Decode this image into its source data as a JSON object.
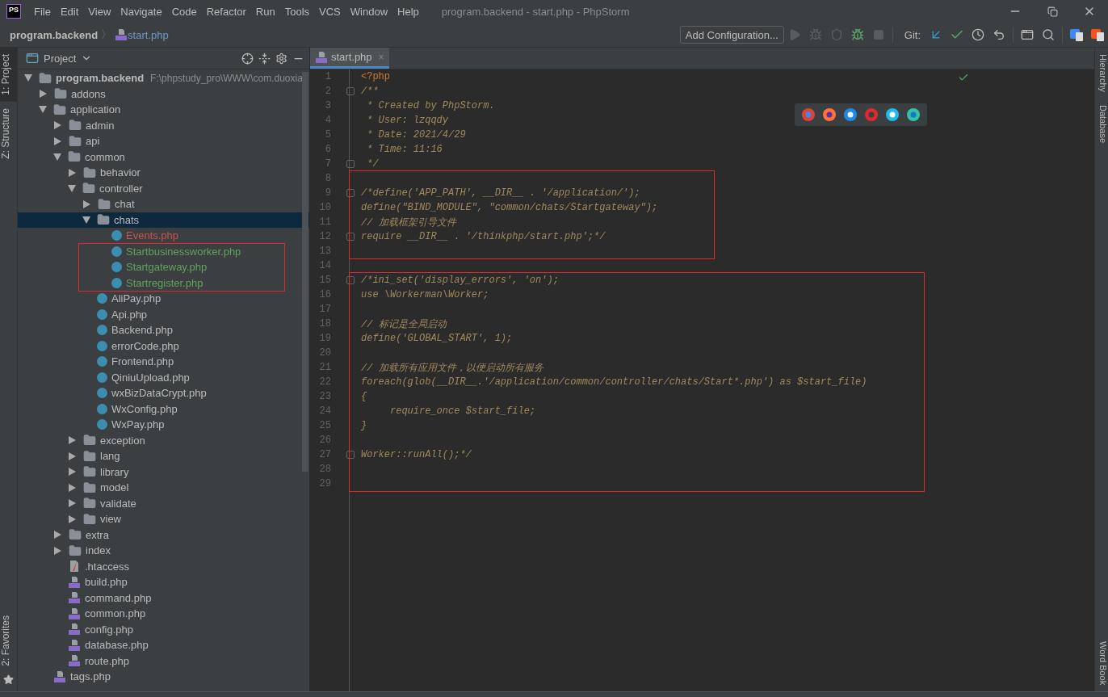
{
  "title_bar": {
    "logo": "PS",
    "menu": [
      "File",
      "Edit",
      "View",
      "Navigate",
      "Code",
      "Refactor",
      "Run",
      "Tools",
      "VCS",
      "Window",
      "Help"
    ],
    "title": "program.backend - start.php - PhpStorm"
  },
  "nav_bar": {
    "breadcrumb": [
      {
        "label": "program.backend",
        "kind": "project"
      },
      {
        "label": "start.php",
        "kind": "php"
      }
    ],
    "separator": "〉",
    "config_button": "Add Configuration...",
    "git_label": "Git:"
  },
  "left_strip": {
    "top": [
      {
        "label": "1: Project",
        "selected": true
      },
      {
        "label": "Z: Structure",
        "selected": false
      }
    ],
    "bottom": [
      {
        "label": "2: Favorites",
        "selected": false
      }
    ]
  },
  "project_panel": {
    "title": "Project",
    "tree": [
      {
        "label": "program.backend",
        "path": "F:\\phpstudy_pro\\WWW\\com.duoxia",
        "kind": "folder",
        "expanded": true,
        "selected": false,
        "children": [
          {
            "label": "addons",
            "kind": "folder",
            "expanded": false,
            "selected": false
          },
          {
            "label": "application",
            "kind": "folder",
            "expanded": true,
            "selected": false,
            "children": [
              {
                "label": "admin",
                "kind": "folder",
                "expanded": false,
                "selected": false
              },
              {
                "label": "api",
                "kind": "folder",
                "expanded": false,
                "selected": false
              },
              {
                "label": "common",
                "kind": "folder",
                "expanded": true,
                "selected": false,
                "children": [
                  {
                    "label": "behavior",
                    "kind": "folder",
                    "expanded": false,
                    "selected": false
                  },
                  {
                    "label": "controller",
                    "kind": "folder",
                    "expanded": true,
                    "selected": false,
                    "children": [
                      {
                        "label": "chat",
                        "kind": "folder",
                        "expanded": false,
                        "selected": false
                      },
                      {
                        "label": "chats",
                        "kind": "folder",
                        "expanded": true,
                        "selected": true,
                        "children": [
                          {
                            "label": "Events.php",
                            "kind": "class",
                            "selected": false,
                            "color": "#c75450",
                            "marked": false
                          },
                          {
                            "label": "Startbusinessworker.php",
                            "kind": "class",
                            "selected": false,
                            "color": "#62a15c",
                            "marked": true
                          },
                          {
                            "label": "Startgateway.php",
                            "kind": "class",
                            "selected": false,
                            "color": "#62a15c",
                            "marked": true
                          },
                          {
                            "label": "Startregister.php",
                            "kind": "class",
                            "selected": false,
                            "color": "#62a15c",
                            "marked": true
                          }
                        ]
                      },
                      {
                        "label": "AliPay.php",
                        "kind": "class",
                        "selected": false
                      },
                      {
                        "label": "Api.php",
                        "kind": "class",
                        "selected": false
                      },
                      {
                        "label": "Backend.php",
                        "kind": "class",
                        "selected": false
                      },
                      {
                        "label": "errorCode.php",
                        "kind": "class",
                        "selected": false
                      },
                      {
                        "label": "Frontend.php",
                        "kind": "class",
                        "selected": false
                      },
                      {
                        "label": "QiniuUpload.php",
                        "kind": "class",
                        "selected": false
                      },
                      {
                        "label": "wxBizDataCrypt.php",
                        "kind": "class",
                        "selected": false
                      },
                      {
                        "label": "WxConfig.php",
                        "kind": "class",
                        "selected": false
                      },
                      {
                        "label": "WxPay.php",
                        "kind": "class",
                        "selected": false
                      }
                    ]
                  },
                  {
                    "label": "exception",
                    "kind": "folder",
                    "expanded": false,
                    "selected": false
                  },
                  {
                    "label": "lang",
                    "kind": "folder",
                    "expanded": false,
                    "selected": false
                  },
                  {
                    "label": "library",
                    "kind": "folder",
                    "expanded": false,
                    "selected": false
                  },
                  {
                    "label": "model",
                    "kind": "folder",
                    "expanded": false,
                    "selected": false
                  },
                  {
                    "label": "validate",
                    "kind": "folder",
                    "expanded": false,
                    "selected": false
                  },
                  {
                    "label": "view",
                    "kind": "folder",
                    "expanded": false,
                    "selected": false
                  }
                ]
              },
              {
                "label": "extra",
                "kind": "folder",
                "expanded": false,
                "selected": false
              },
              {
                "label": "index",
                "kind": "folder",
                "expanded": false,
                "selected": false
              },
              {
                "label": ".htaccess",
                "kind": "htaccess",
                "selected": false
              },
              {
                "label": "build.php",
                "kind": "php",
                "selected": false
              },
              {
                "label": "command.php",
                "kind": "php",
                "selected": false
              },
              {
                "label": "common.php",
                "kind": "php",
                "selected": false
              },
              {
                "label": "config.php",
                "kind": "php",
                "selected": false
              },
              {
                "label": "database.php",
                "kind": "php",
                "selected": false
              },
              {
                "label": "route.php",
                "kind": "php",
                "selected": false
              }
            ]
          },
          {
            "label": "tags.php",
            "kind": "php",
            "selected": false
          }
        ]
      }
    ]
  },
  "editor": {
    "tab": {
      "label": "start.php",
      "close": "×",
      "selected": true
    },
    "blocks": [
      {
        "marked": false,
        "lines": [
          {
            "n": "1",
            "text": "<?php",
            "kind": "tag",
            "fold": false
          },
          {
            "n": "2",
            "text": "/**",
            "kind": "comment",
            "fold": true
          },
          {
            "n": "3",
            "text": " * Created by PhpStorm.",
            "kind": "comment",
            "fold": false
          },
          {
            "n": "4",
            "text": " * User: lzqqdy",
            "kind": "comment",
            "fold": false
          },
          {
            "n": "5",
            "text": " * Date: 2021/4/29",
            "kind": "comment",
            "fold": false
          },
          {
            "n": "6",
            "text": " * Time: 11:16",
            "kind": "comment",
            "fold": false
          },
          {
            "n": "7",
            "text": " */",
            "kind": "comment",
            "fold": true
          }
        ]
      },
      {
        "marked": true,
        "lines": [
          {
            "n": "8",
            "fold": false
          },
          {
            "n": "9",
            "text": "/*define('APP_PATH', __DIR__ . '/application/');",
            "kind": "comment",
            "fold": true
          },
          {
            "n": "10",
            "text": "define(\"BIND_MODULE\", \"common/chats/Startgateway\");",
            "kind": "comment",
            "fold": false
          },
          {
            "n": "11",
            "text": "// 加载框架引导文件",
            "kind": "comment",
            "fold": false
          },
          {
            "n": "12",
            "text": "require __DIR__ . '/thinkphp/start.php';*/",
            "kind": "comment",
            "fold": true
          },
          {
            "n": "13",
            "fold": false
          }
        ]
      },
      {
        "marked": false,
        "lines": [
          {
            "n": "14",
            "fold": false
          }
        ]
      },
      {
        "marked": true,
        "lines": [
          {
            "n": "15",
            "text": "/*ini_set('display_errors', 'on');",
            "kind": "comment",
            "fold": true
          },
          {
            "n": "16",
            "text": "use \\Workerman\\Worker;",
            "kind": "comment",
            "fold": false
          },
          {
            "n": "17",
            "fold": false
          },
          {
            "n": "18",
            "text": "// 标记是全局启动",
            "kind": "comment",
            "fold": false
          },
          {
            "n": "19",
            "text": "define('GLOBAL_START', 1);",
            "kind": "comment",
            "fold": false
          },
          {
            "n": "20",
            "fold": false
          },
          {
            "n": "21",
            "text": "// 加载所有应用文件，以便启动所有服务",
            "kind": "comment",
            "fold": false
          },
          {
            "n": "22",
            "text": "foreach(glob(__DIR__.'/application/common/controller/chats/Start*.php') as $start_file)",
            "kind": "comment",
            "fold": false
          },
          {
            "n": "23",
            "text": "{",
            "kind": "comment",
            "fold": false
          },
          {
            "n": "24",
            "text": "     require_once $start_file;",
            "kind": "comment",
            "fold": false
          },
          {
            "n": "25",
            "text": "}",
            "kind": "comment",
            "fold": false
          },
          {
            "n": "26",
            "fold": false
          },
          {
            "n": "27",
            "text": "Worker::runAll();*/",
            "kind": "comment",
            "fold": true
          },
          {
            "n": "28",
            "fold": false
          },
          {
            "n": "29",
            "fold": false
          }
        ]
      }
    ]
  },
  "right_strip": [
    "Hierarchy",
    "Database",
    "Word Book"
  ]
}
